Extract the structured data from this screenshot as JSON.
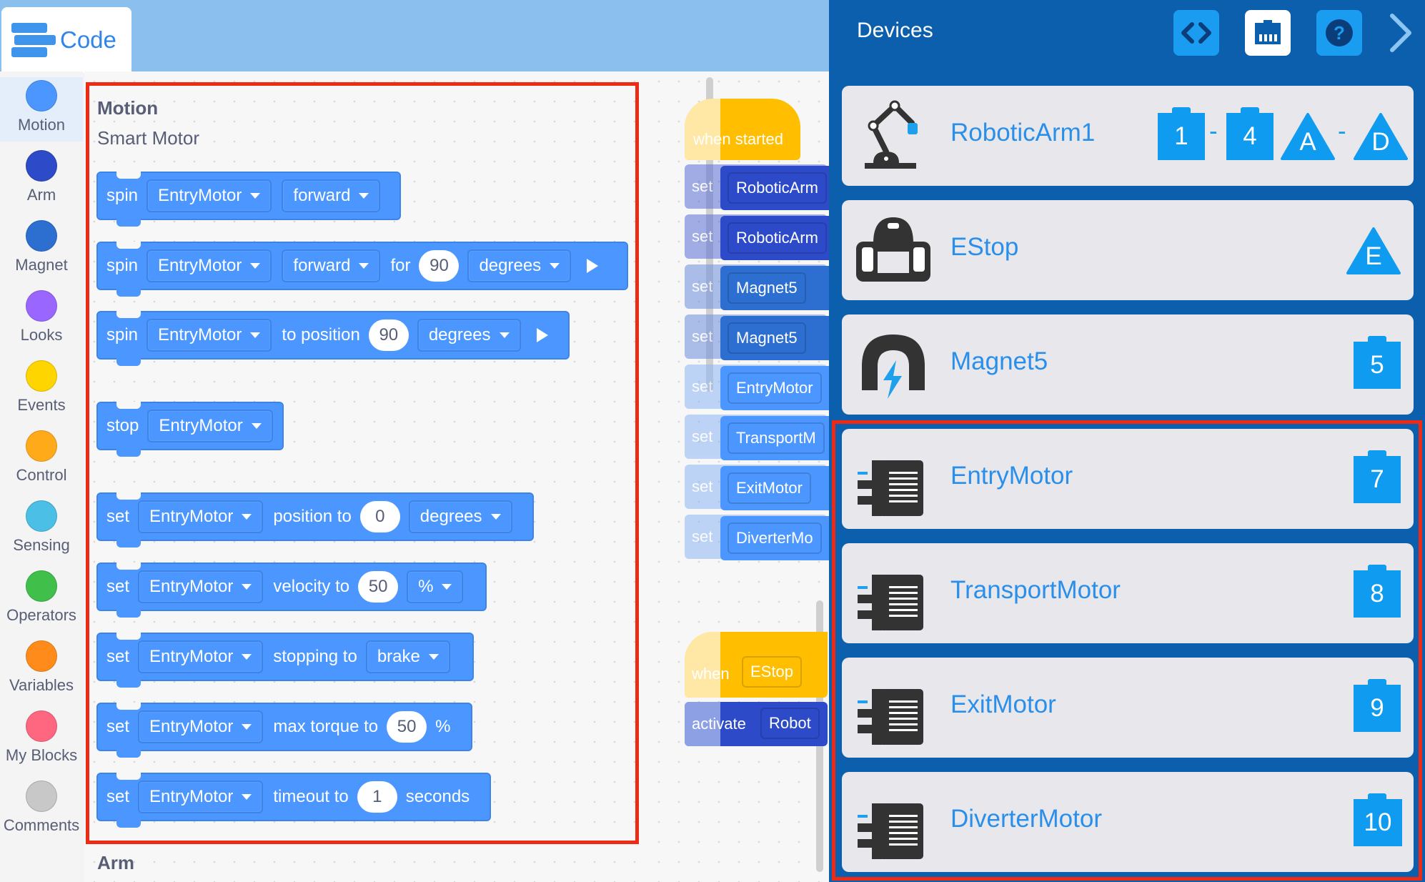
{
  "topbar": {
    "code_tab_label": "Code"
  },
  "categories": [
    {
      "name": "Motion",
      "color": "#4c97ff"
    },
    {
      "name": "Arm",
      "color": "#2d4bc8"
    },
    {
      "name": "Magnet",
      "color": "#2d6fd0"
    },
    {
      "name": "Looks",
      "color": "#9966ff"
    },
    {
      "name": "Events",
      "color": "#ffd500"
    },
    {
      "name": "Control",
      "color": "#ffab19"
    },
    {
      "name": "Sensing",
      "color": "#4cbfe6"
    },
    {
      "name": "Operators",
      "color": "#40bf4a"
    },
    {
      "name": "Variables",
      "color": "#ff8c1a"
    },
    {
      "name": "My Blocks",
      "color": "#ff6680"
    },
    {
      "name": "Comments",
      "color": "#c8c8c8"
    }
  ],
  "palette": {
    "section_title": "Motion",
    "section_subtitle": "Smart Motor",
    "next_section_title": "Arm",
    "blocks": {
      "spin1": {
        "kw": "spin",
        "motor": "EntryMotor",
        "dir": "forward"
      },
      "spin2": {
        "kw": "spin",
        "motor": "EntryMotor",
        "dir": "forward",
        "for": "for",
        "value": "90",
        "unit": "degrees"
      },
      "spin3": {
        "kw": "spin",
        "motor": "EntryMotor",
        "text": "to position",
        "value": "90",
        "unit": "degrees"
      },
      "stop": {
        "kw": "stop",
        "motor": "EntryMotor"
      },
      "setpos": {
        "kw": "set",
        "motor": "EntryMotor",
        "text": "position to",
        "value": "0",
        "unit": "degrees"
      },
      "setvel": {
        "kw": "set",
        "motor": "EntryMotor",
        "text": "velocity to",
        "value": "50",
        "unit": "%"
      },
      "setstop": {
        "kw": "set",
        "motor": "EntryMotor",
        "text": "stopping to",
        "mode": "brake"
      },
      "settorque": {
        "kw": "set",
        "motor": "EntryMotor",
        "text": "max torque to",
        "value": "50",
        "unit": "%"
      },
      "settimeout": {
        "kw": "set",
        "motor": "EntryMotor",
        "text": "timeout to",
        "value": "1",
        "unit": "seconds"
      }
    }
  },
  "workspace": {
    "hat1": "when started",
    "ghost_set": "set",
    "script1": [
      "RoboticArm",
      "RoboticArm",
      "Magnet5",
      "Magnet5",
      "EntryMotor",
      "TransportM",
      "ExitMotor",
      "DiverterMo"
    ],
    "hat2_when": "when",
    "hat2_dd": "EStop",
    "activate_kw": "activate",
    "activate_dd": "Robot"
  },
  "devices": {
    "title": "Devices",
    "list": [
      {
        "name": "RoboticArm1",
        "ports": [
          "1",
          "-",
          "4",
          "A",
          "-",
          "D"
        ]
      },
      {
        "name": "EStop",
        "ports": [
          "E"
        ]
      },
      {
        "name": "Magnet5",
        "ports": [
          "5"
        ]
      },
      {
        "name": "EntryMotor",
        "ports": [
          "7"
        ]
      },
      {
        "name": "TransportMotor",
        "ports": [
          "8"
        ]
      },
      {
        "name": "ExitMotor",
        "ports": [
          "9"
        ]
      },
      {
        "name": "DiverterMotor",
        "ports": [
          "10"
        ]
      }
    ]
  },
  "colors": {
    "motion_block": "#4c97ff",
    "arm_block": "#2d4bc8",
    "events_block": "#ffbf00",
    "devices_bg": "#0b5fad",
    "device_name": "#2a8fea",
    "port_badge": "#0f9bf0",
    "highlight": "#ee2a14"
  }
}
